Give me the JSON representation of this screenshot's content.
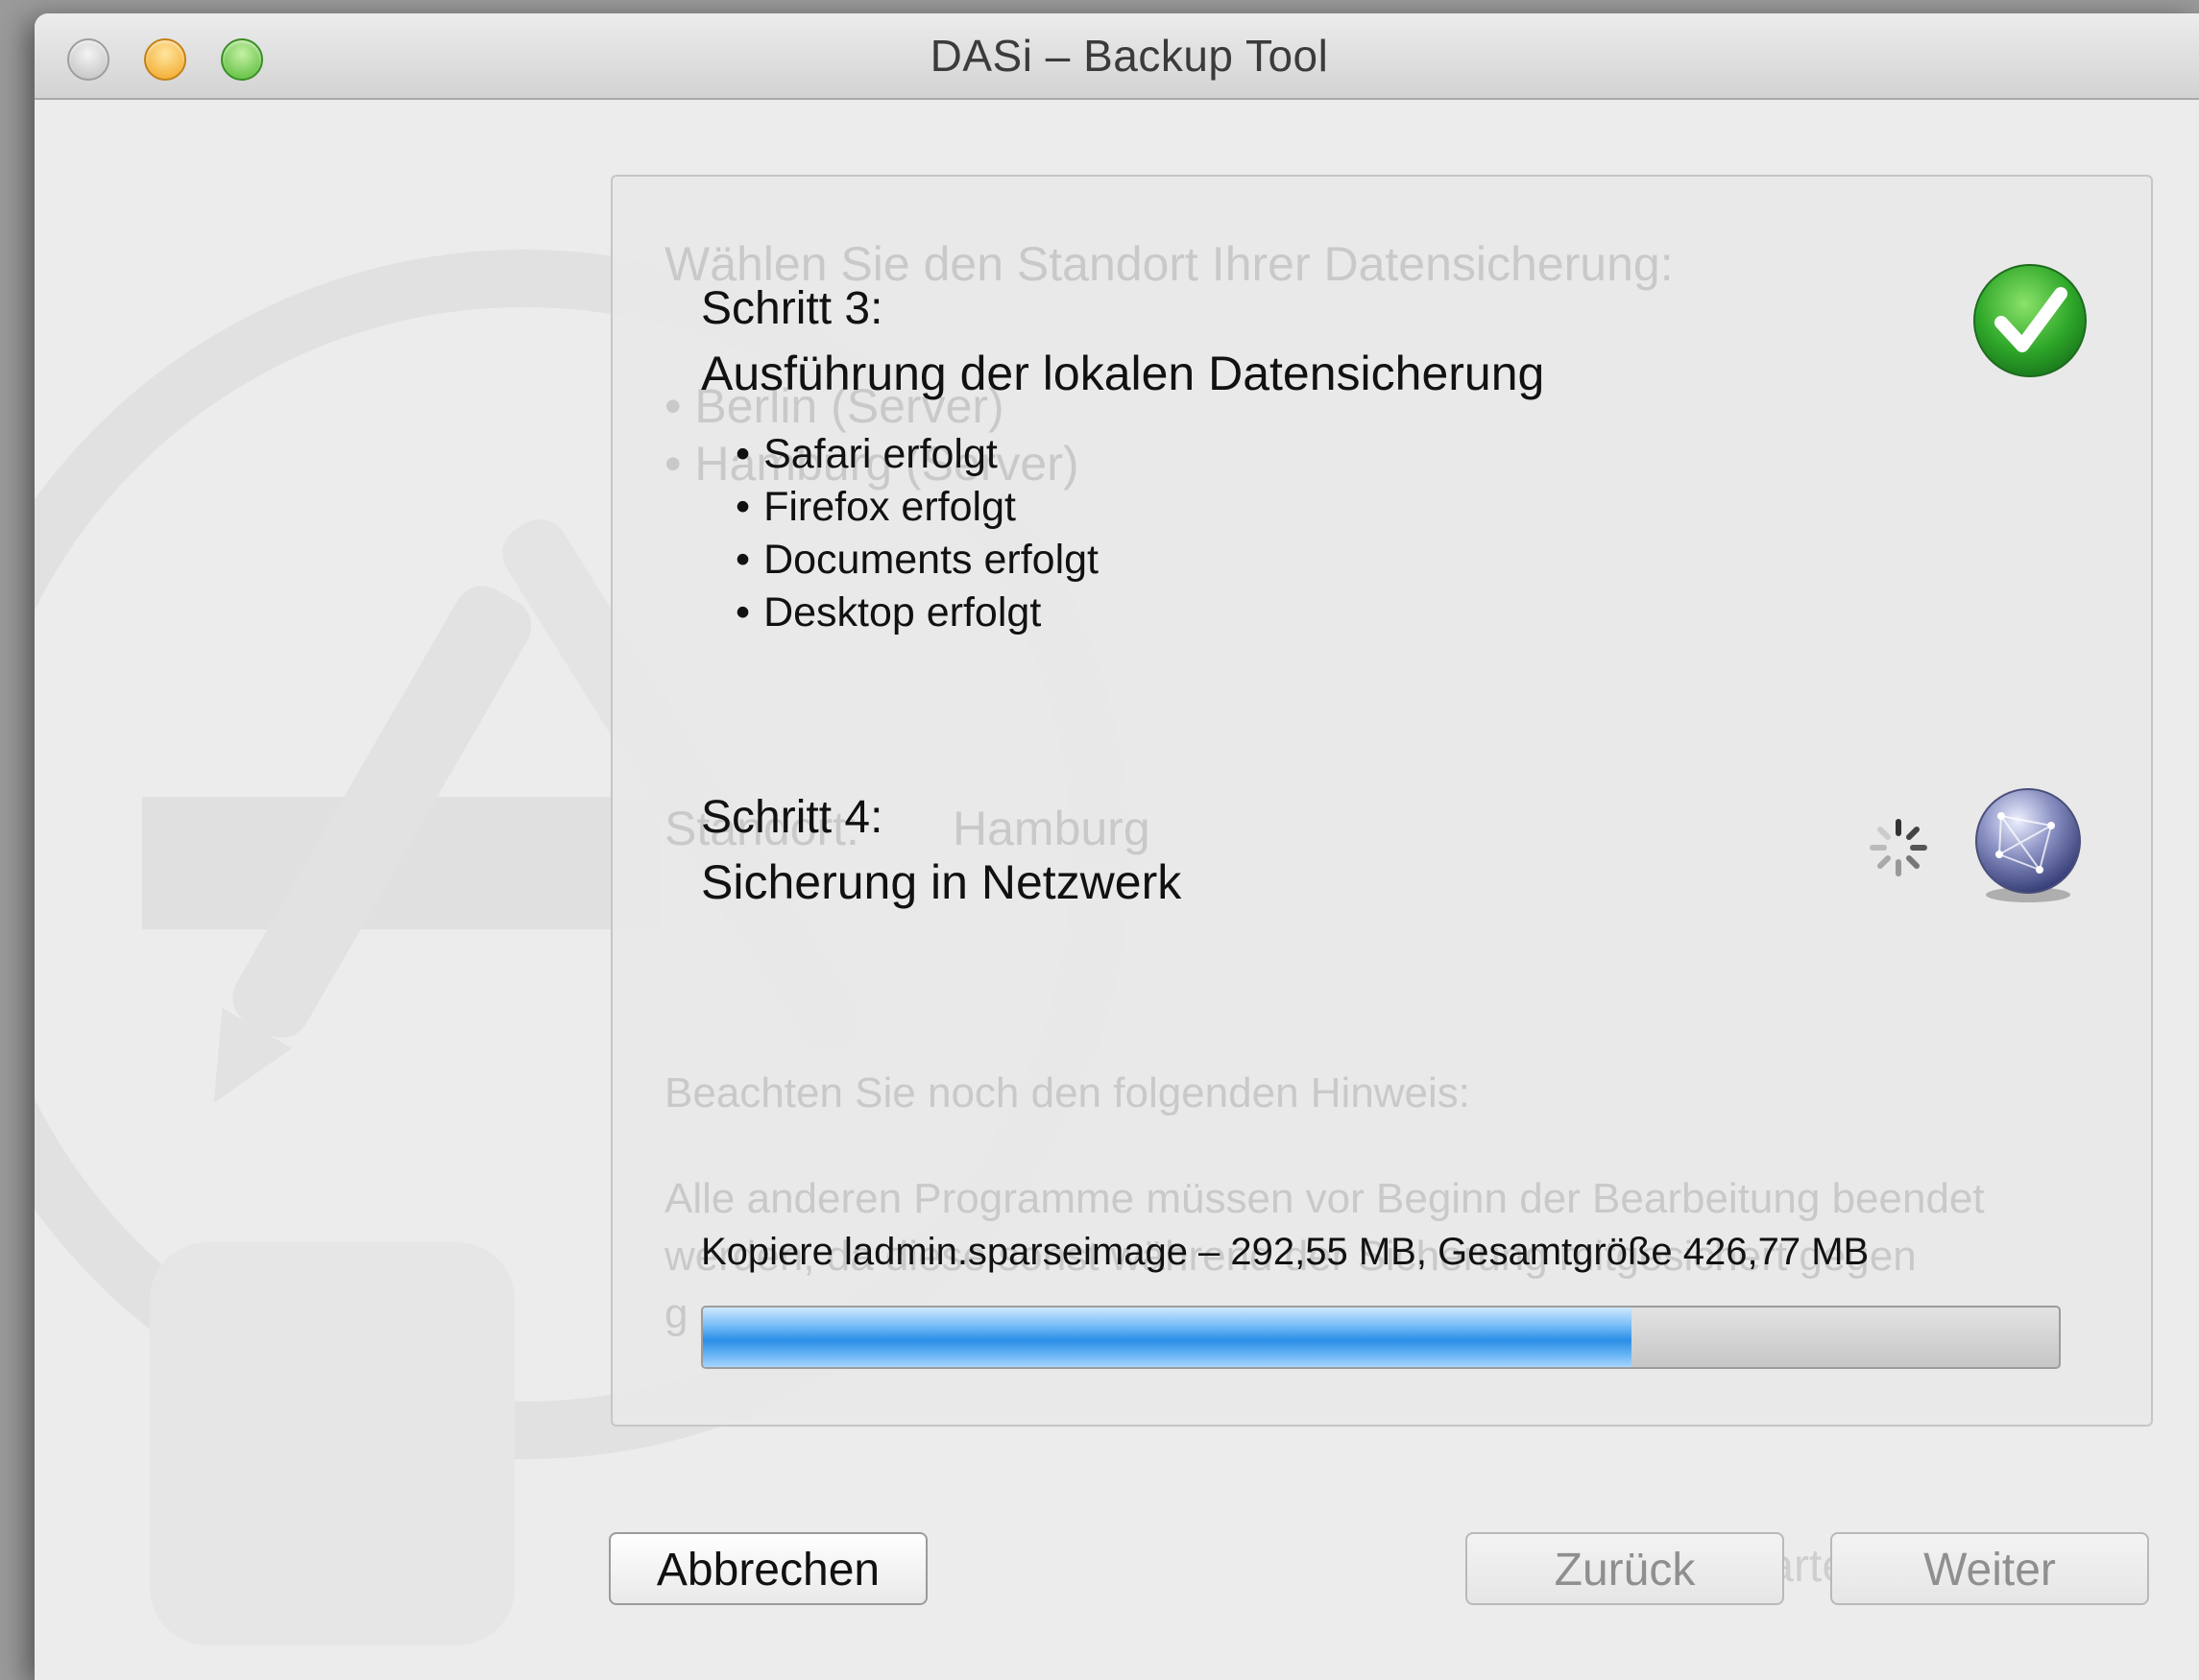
{
  "window": {
    "title": "DASi – Backup Tool"
  },
  "ghost_text": {
    "heading": "Wählen Sie den Standort Ihrer Datensicherung:",
    "option1": "• Berlin (Server)",
    "option2": "• Hamburg (Server)",
    "standort_label": "Standort:",
    "standort_value": "Hamburg",
    "note_heading": "Beachten Sie noch den folgenden Hinweis:",
    "note_line1": "Alle anderen Programme müssen vor Beginn der Bearbeitung beendet",
    "note_line2": "werden, da diese sonst während der Sicherung mitgesichert gegen",
    "note_line3": "g",
    "start_button": "Starten"
  },
  "step3": {
    "number": "Schritt 3:",
    "title": "Ausführung der lokalen Datensicherung",
    "items": [
      "Safari erfolgt",
      "Firefox erfolgt",
      "Documents erfolgt",
      "Desktop erfolgt"
    ],
    "status_icon": "checkmark-icon"
  },
  "step4": {
    "number": "Schritt 4:",
    "title": "Sicherung in Netzwerk",
    "status_icon": "spinner-icon",
    "network_icon": "network-globe-icon"
  },
  "progress": {
    "label": "Kopiere ladmin.sparseimage – 292,55 MB, Gesamtgröße 426,77 MB",
    "fraction": 0.685
  },
  "buttons": {
    "cancel": "Abbrechen",
    "back": "Zurück",
    "next": "Weiter"
  },
  "colors": {
    "check_green": "#2fa82a",
    "progress_blue": "#2a8ee6"
  }
}
